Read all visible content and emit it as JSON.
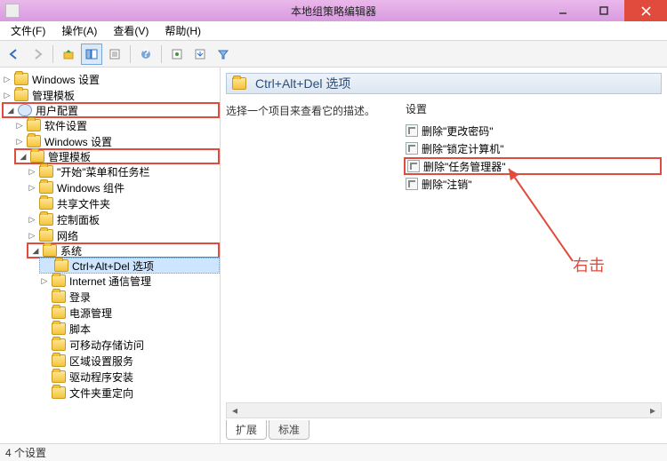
{
  "window": {
    "title": "本地组策略编辑器"
  },
  "menus": {
    "file": "文件(F)",
    "action": "操作(A)",
    "view": "查看(V)",
    "help": "帮助(H)"
  },
  "tree": {
    "win_settings_top": "Windows 设置",
    "admin_templates_top": "管理模板",
    "user_config": "用户配置",
    "software_settings": "软件设置",
    "win_settings": "Windows 设置",
    "admin_templates": "管理模板",
    "start_taskbar": "\"开始\"菜单和任务栏",
    "win_components": "Windows 组件",
    "shared_folders": "共享文件夹",
    "control_panel": "控制面板",
    "network": "网络",
    "system": "系统",
    "cad_options": "Ctrl+Alt+Del 选项",
    "internet_comm": "Internet 通信管理",
    "logon": "登录",
    "power": "电源管理",
    "scripts": "脚本",
    "removable": "可移动存储访问",
    "locale_svc": "区域设置服务",
    "driver_install": "驱动程序安装",
    "folder_redir": "文件夹重定向"
  },
  "content": {
    "title": "Ctrl+Alt+Del 选项",
    "desc": "选择一个项目来查看它的描述。",
    "col_header": "设置",
    "items": {
      "chg_pwd": "删除\"更改密码\"",
      "lock": "删除\"锁定计算机\"",
      "taskmgr": "删除\"任务管理器\"",
      "logoff": "删除\"注销\""
    }
  },
  "annot": {
    "label": "右击"
  },
  "tabs": {
    "extended": "扩展",
    "standard": "标准"
  },
  "status": {
    "text": "4 个设置"
  }
}
